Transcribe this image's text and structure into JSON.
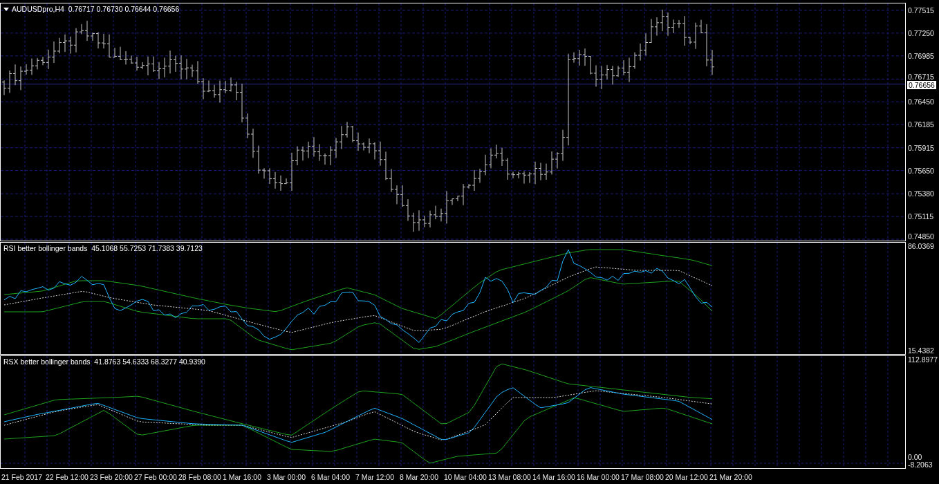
{
  "chart_header": {
    "symbol": "AUDUSDpro,H4",
    "values": "0.76717 0.76730 0.76644 0.76656"
  },
  "price_axis": {
    "ticks": [
      "0.77515",
      "0.77250",
      "0.76985",
      "0.76715",
      "0.76450",
      "0.76185",
      "0.75915",
      "0.75650",
      "0.75380",
      "0.75115",
      "0.74850"
    ],
    "current_price": "0.76656"
  },
  "indicators": [
    {
      "kind": "rsi",
      "title": "RSI better bollinger bands",
      "values": "45.1068 55.7253 71.7383 39.7123",
      "max": "86.0369",
      "min": "15.4382"
    },
    {
      "kind": "rsx",
      "title": "RSX better bollinger bands",
      "values": "41.8763 54.6333 68.3277 40.9390",
      "max": "112.8977",
      "min": "-8.2063",
      "zero": "0.00"
    }
  ],
  "time_axis": [
    "21 Feb 2017",
    "22 Feb 12:00",
    "23 Feb 20:00",
    "27 Feb 00:00",
    "28 Feb 08:00",
    "1 Mar 16:00",
    "3 Mar 00:00",
    "6 Mar 04:00",
    "7 Mar 12:00",
    "8 Mar 20:00",
    "10 Mar 04:00",
    "13 Mar 08:00",
    "14 Mar 16:00",
    "16 Mar 00:00",
    "17 Mar 08:00",
    "20 Mar 12:00",
    "21 Mar 20:00"
  ]
}
